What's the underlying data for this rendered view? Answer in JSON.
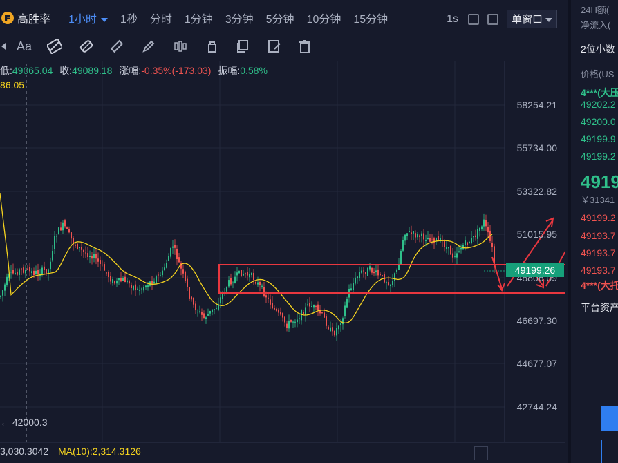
{
  "header": {
    "brand": "高胜率",
    "timeframes": [
      "1小时",
      "1秒",
      "分时",
      "1分钟",
      "3分钟",
      "5分钟",
      "10分钟",
      "15分钟"
    ],
    "refresh": "1s",
    "window_mode": "单窗口"
  },
  "ohlc": {
    "low_label": "低:",
    "low": "49065.04",
    "close_label": "收:",
    "close": "49089.18",
    "change_label": "涨幅:",
    "change": "-0.35%(-173.03)",
    "amp_label": "振幅:",
    "amp": "0.58%",
    "ma_value": "86.05"
  },
  "price_axis": [
    "58254.21",
    "55734.00",
    "53322.82",
    "51015.95",
    "48806.09",
    "46697.30",
    "44677.07",
    "42744.24"
  ],
  "current_price": "49199.26",
  "low_marker": "42000.3",
  "volume": {
    "vol": "3,030.3042",
    "ma10": "MA(10):2,314.3126"
  },
  "side": {
    "h24": "24H额(",
    "net": "净流入(",
    "decimals": "2位小数",
    "price_col": "价格(US",
    "asks": [
      "4***(大压",
      "49202.2",
      "49200.0",
      "49199.9",
      "49199.2"
    ],
    "big_price": "4919",
    "cny": "￥31341",
    "bids": [
      "49199.2",
      "49193.7",
      "49193.7",
      "49193.7",
      "4***(大托"
    ],
    "assets": "平台资产"
  },
  "colors": {
    "up": "#2fbf8a",
    "down": "#ef5350",
    "ma": "#f4d21f",
    "accent": "#4c8df6",
    "box": "#e8373f"
  }
}
